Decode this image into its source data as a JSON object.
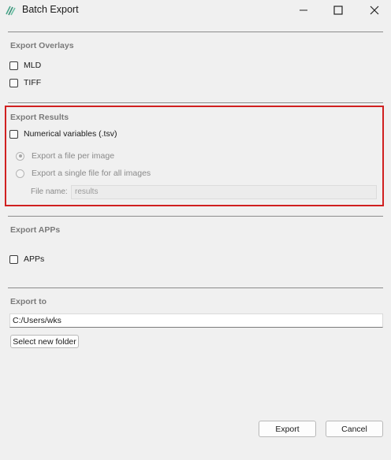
{
  "window": {
    "title": "Batch Export",
    "minimize_icon": "minimize-icon",
    "maximize_icon": "maximize-icon",
    "close_icon": "close-icon"
  },
  "overlays": {
    "heading": "Export Overlays",
    "options": [
      {
        "label": "MLD",
        "checked": false
      },
      {
        "label": "TIFF",
        "checked": false
      }
    ]
  },
  "results": {
    "heading": "Export Results",
    "numerical": {
      "label": "Numerical variables (.tsv)",
      "checked": false
    },
    "radio_per_image": {
      "label": "Export a file per image",
      "selected": true,
      "enabled": false
    },
    "radio_single": {
      "label": "Export a single file for all images",
      "selected": false,
      "enabled": false
    },
    "file_name_label": "File name:",
    "file_name_value": "results"
  },
  "apps": {
    "heading": "Export APPs",
    "option": {
      "label": "APPs",
      "checked": false
    }
  },
  "export_to": {
    "heading": "Export to",
    "path": "C:/Users/wks",
    "select_button": "Select new folder"
  },
  "footer": {
    "export_button": "Export",
    "cancel_button": "Cancel"
  },
  "colors": {
    "highlight": "#d02020",
    "background": "#f0f0f0",
    "logo": "#4aa58a"
  }
}
